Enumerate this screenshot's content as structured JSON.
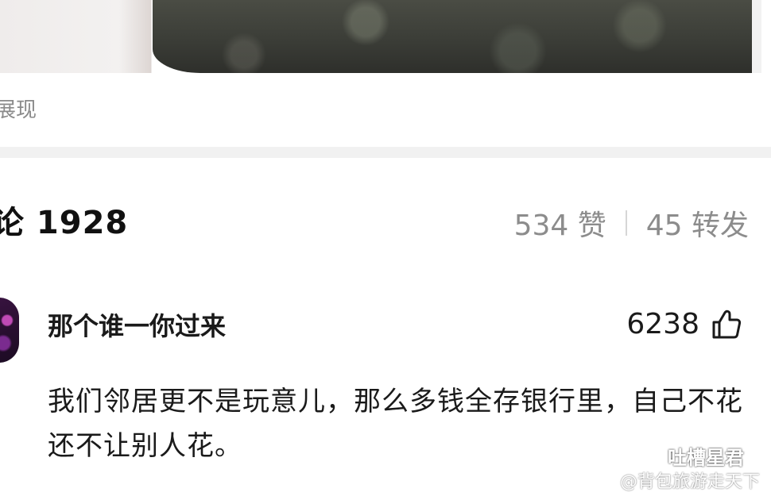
{
  "post": {
    "expand_label": "展现"
  },
  "stats": {
    "comments": "论 1928",
    "likes": "534 赞",
    "reposts": "45 转发"
  },
  "comment": {
    "username": "那个谁一你过来",
    "like_count": "6238",
    "text": "我们邻居更不是玩意儿，那么多钱全存银行里，自己不花还不让别人花。"
  },
  "watermark": {
    "line1": "吐槽星君",
    "line2": "@背包旅游走天下"
  },
  "icons": {
    "like": "thumbs-up-icon",
    "wechat": "wechat-icon",
    "weibo": "weibo-icon"
  }
}
